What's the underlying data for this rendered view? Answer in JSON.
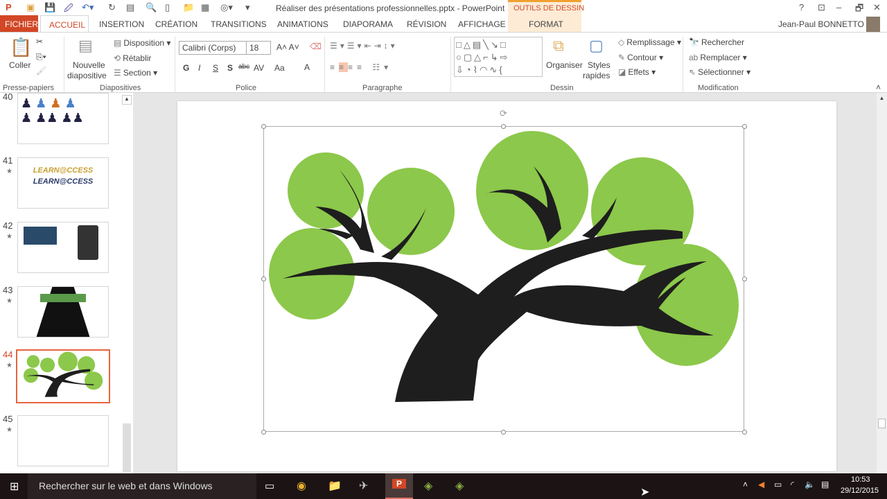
{
  "window": {
    "title": "Réaliser des présentations professionnelles.pptx - PowerPoint",
    "context_tab_group": "OUTILS DE DESSIN",
    "user": "Jean-Paul BONNETTO",
    "help": "?",
    "minimize": "–",
    "restore": "🗗",
    "close": "✕"
  },
  "tabs": [
    "FICHIER",
    "ACCUEIL",
    "INSERTION",
    "CRÉATION",
    "TRANSITIONS",
    "ANIMATIONS",
    "DIAPORAMA",
    "RÉVISION",
    "AFFICHAGE",
    "FORMAT"
  ],
  "ribbon": {
    "clipboard": {
      "paste": "Coller",
      "group": "Presse-papiers"
    },
    "slides": {
      "new_slide_1": "Nouvelle",
      "new_slide_2": "diapositive",
      "layout": "Disposition",
      "reset": "Rétablir",
      "section": "Section",
      "group": "Diapositives"
    },
    "font": {
      "name": "Calibri (Corps)",
      "size": "18",
      "bold": "G",
      "italic": "I",
      "underline": "S",
      "shadow": "S",
      "strike": "abc",
      "spacing": "AV",
      "case": "Aa",
      "color": "A",
      "group": "Police"
    },
    "paragraph": {
      "group": "Paragraphe"
    },
    "drawing": {
      "arrange": "Organiser",
      "quick_styles_1": "Styles",
      "quick_styles_2": "rapides",
      "fill": "Remplissage",
      "outline": "Contour",
      "effects": "Effets",
      "group": "Dessin"
    },
    "editing": {
      "find": "Rechercher",
      "replace": "Remplacer",
      "select": "Sélectionner",
      "group": "Modification"
    }
  },
  "slides": [
    {
      "num": "40"
    },
    {
      "num": "41",
      "text": "LEARN@CCESS"
    },
    {
      "num": "42"
    },
    {
      "num": "43"
    },
    {
      "num": "44",
      "selected": true
    },
    {
      "num": "45"
    }
  ],
  "taskbar": {
    "search": "Rechercher sur le web et dans Windows",
    "time": "10:53",
    "date": "29/12/2015"
  },
  "colors": {
    "accent": "#d24726",
    "leaf": "#8cc84b",
    "trunk": "#1e1e1e"
  }
}
